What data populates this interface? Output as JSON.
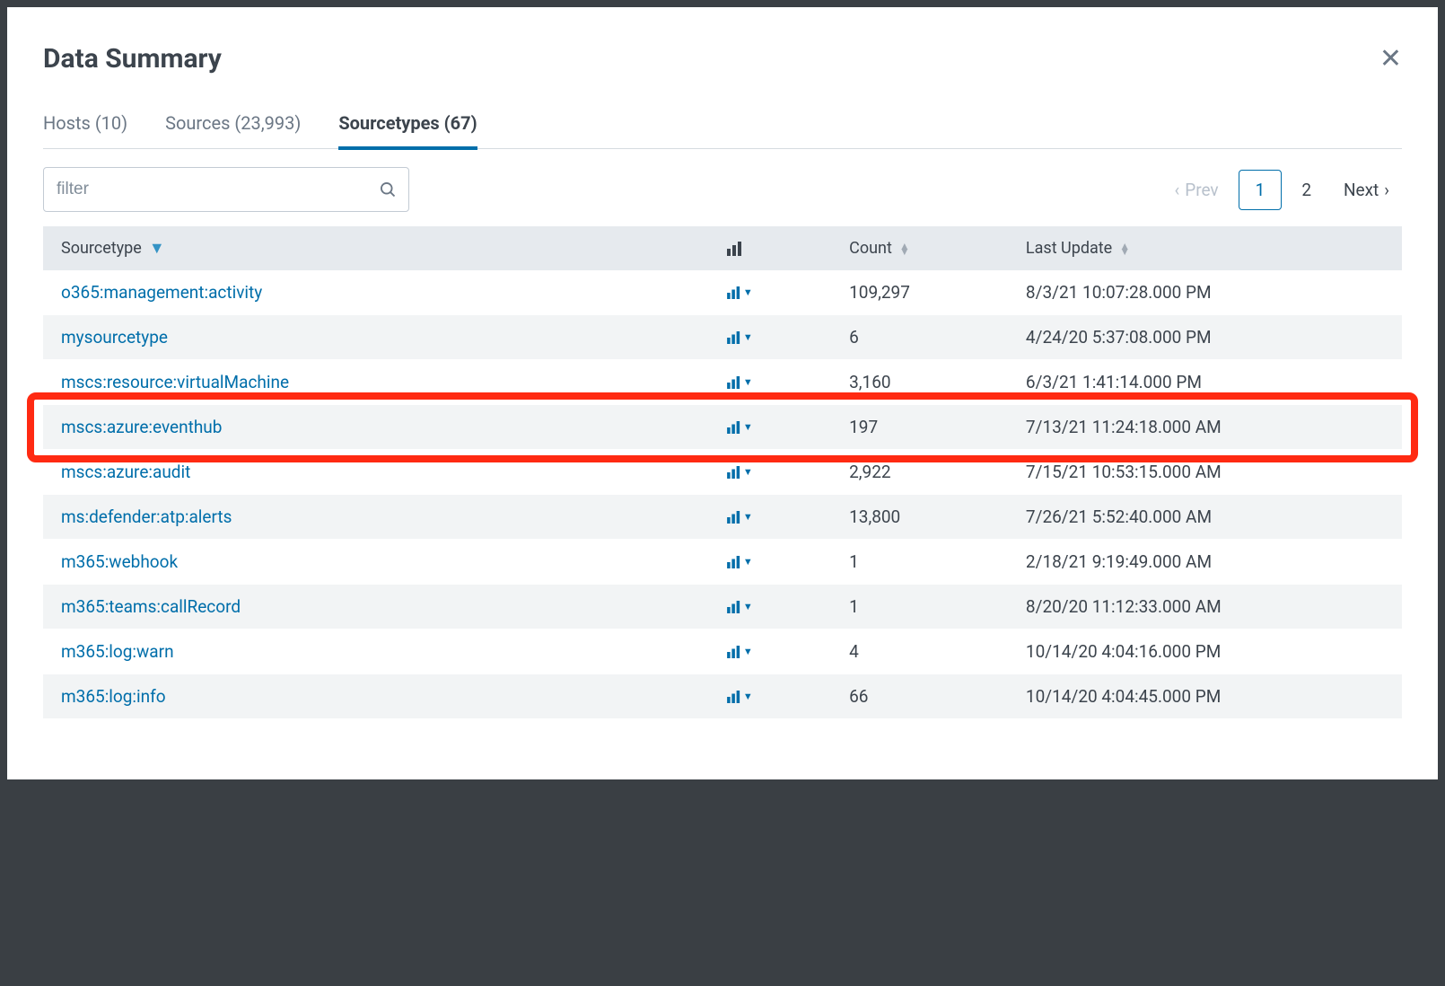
{
  "modal": {
    "title": "Data Summary"
  },
  "tabs": [
    {
      "label": "Hosts (10)",
      "active": false
    },
    {
      "label": "Sources (23,993)",
      "active": false
    },
    {
      "label": "Sourcetypes (67)",
      "active": true
    }
  ],
  "filter": {
    "placeholder": "filter"
  },
  "pagination": {
    "prev": "Prev",
    "next": "Next",
    "pages": [
      "1",
      "2"
    ],
    "current": "1"
  },
  "columns": {
    "sourcetype": "Sourcetype",
    "count": "Count",
    "last_update": "Last Update"
  },
  "rows": [
    {
      "name": "o365:management:activity",
      "count": "109,297",
      "updated": "8/3/21 10:07:28.000 PM",
      "highlight": false
    },
    {
      "name": "mysourcetype",
      "count": "6",
      "updated": "4/24/20 5:37:08.000 PM",
      "highlight": false
    },
    {
      "name": "mscs:resource:virtualMachine",
      "count": "3,160",
      "updated": "6/3/21 1:41:14.000 PM",
      "highlight": false
    },
    {
      "name": "mscs:azure:eventhub",
      "count": "197",
      "updated": "7/13/21 11:24:18.000 AM",
      "highlight": true
    },
    {
      "name": "mscs:azure:audit",
      "count": "2,922",
      "updated": "7/15/21 10:53:15.000 AM",
      "highlight": false
    },
    {
      "name": "ms:defender:atp:alerts",
      "count": "13,800",
      "updated": "7/26/21 5:52:40.000 AM",
      "highlight": false
    },
    {
      "name": "m365:webhook",
      "count": "1",
      "updated": "2/18/21 9:19:49.000 AM",
      "highlight": false
    },
    {
      "name": "m365:teams:callRecord",
      "count": "1",
      "updated": "8/20/20 11:12:33.000 AM",
      "highlight": false
    },
    {
      "name": "m365:log:warn",
      "count": "4",
      "updated": "10/14/20 4:04:16.000 PM",
      "highlight": false
    },
    {
      "name": "m365:log:info",
      "count": "66",
      "updated": "10/14/20 4:04:45.000 PM",
      "highlight": false
    }
  ]
}
